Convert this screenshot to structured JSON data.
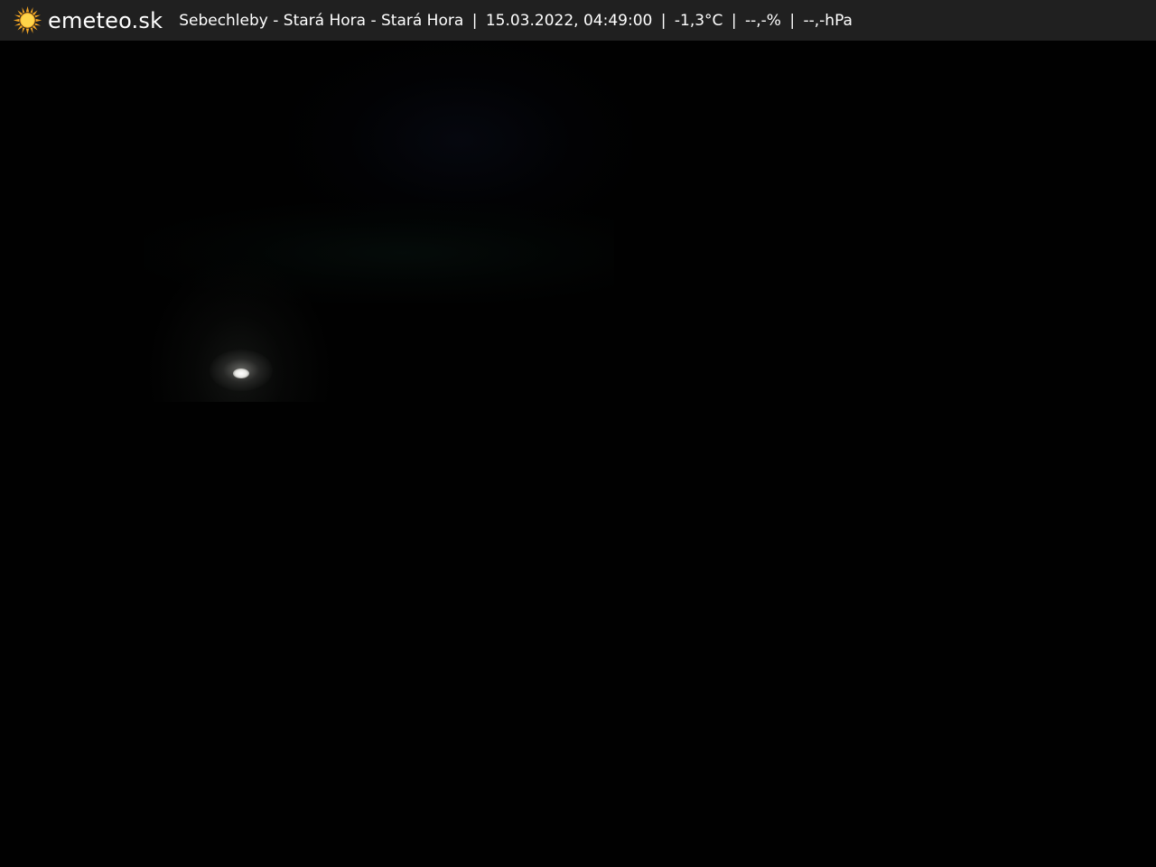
{
  "header": {
    "logo_icon": "sun-icon",
    "brand": "emeteo.sk",
    "location": "Sebechleby - Stará Hora - Stará Hora",
    "datetime": "15.03.2022, 04:49:00",
    "temperature": "-1,3°C",
    "humidity": "--,-%",
    "pressure": "--,-hPa",
    "separator": "|"
  },
  "colors": {
    "bar_background": "#202020",
    "text": "#ffffff",
    "sun_rays": "#f5a623",
    "sun_core": "#ffd54a",
    "scene_background": "#010101"
  }
}
